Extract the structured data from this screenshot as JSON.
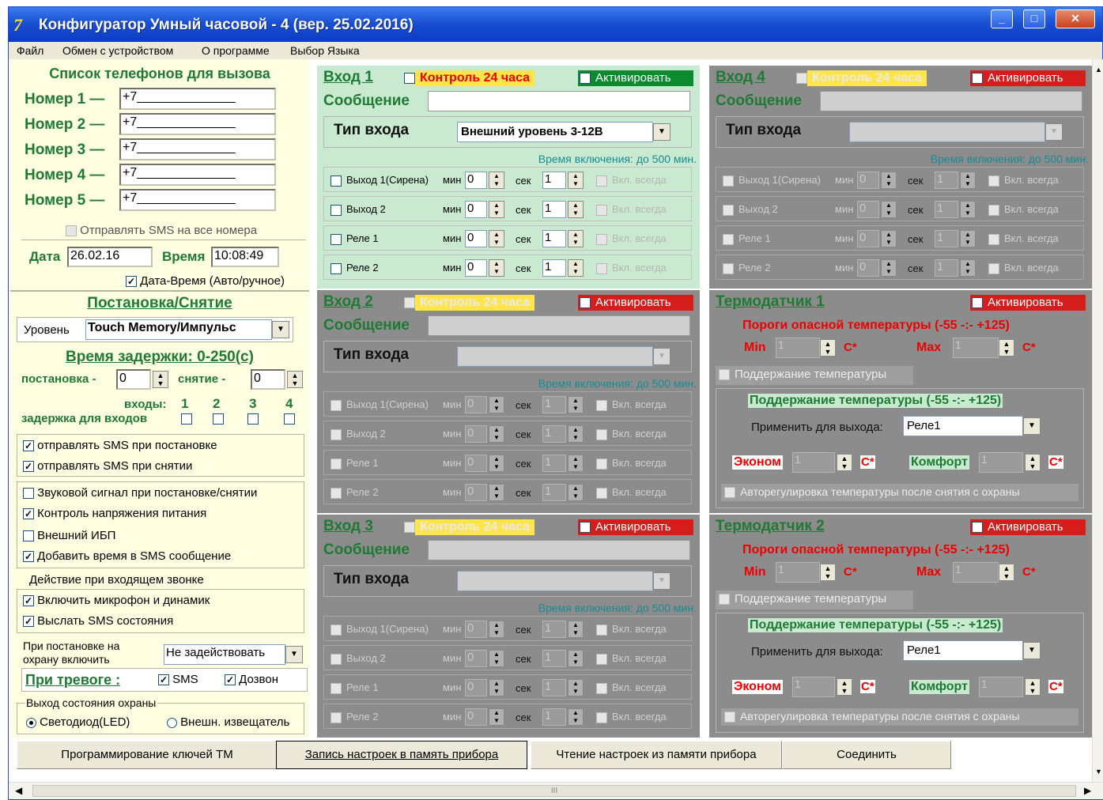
{
  "window": {
    "title": "Конфигуратор Умный часовой - 4 (вер. 25.02.2016)",
    "icon_text": "7"
  },
  "menu": [
    "Файл",
    "Обмен с устройством",
    "О программе",
    "Выбор Языка"
  ],
  "phones": {
    "header": "Список телефонов для вызова",
    "items": [
      {
        "label": "Номер 1 —",
        "value": "+7______________"
      },
      {
        "label": "Номер 2 —",
        "value": "+7______________"
      },
      {
        "label": "Номер 3 —",
        "value": "+7______________"
      },
      {
        "label": "Номер 4 —",
        "value": "+7______________"
      },
      {
        "label": "Номер 5 —",
        "value": "+7______________"
      }
    ],
    "sms_all": "Отправлять SMS на все номера"
  },
  "datetime": {
    "date_label": "Дата",
    "date_value": "26.02.16",
    "time_label": "Время",
    "time_value": "10:08:49",
    "auto_label": "Дата-Время (Авто/ручное)"
  },
  "arming": {
    "header": "Постановка/Снятие",
    "level_label": "Уровень",
    "level_value": "Touch Memory/Импульс",
    "delay_header": "Время задержки: 0-250(с)",
    "set_label": "постановка -",
    "set_value": "0",
    "unset_label": "снятие -",
    "unset_value": "0",
    "inputs_label": "входы:",
    "input_nums": [
      "1",
      "2",
      "3",
      "4"
    ],
    "input_delay_label": "задержка для входов"
  },
  "options": {
    "sms_set": "отправлять SMS при постановке",
    "sms_unset": "отправлять SMS при снятии",
    "sound": "Звуковой сигнал при постановке/снятии",
    "voltage": "Контроль напряжения питания",
    "ups": "Внешний ИБП",
    "time_sms": "Добавить время в SMS сообщение",
    "incoming_header": "Действие при входящем звонке",
    "mic": "Включить микрофон и динамик",
    "send_state": "Выслать SMS состояния",
    "on_arm_label": "При постановке на охрану включить",
    "on_arm_value": "Не задействовать",
    "alarm_label": "При тревоге :",
    "alarm_sms": "SMS",
    "alarm_call": "Дозвон",
    "out_state_label": "Выход состояния охраны",
    "led": "Светодиод(LED)",
    "ext": "Внешн. извещатель"
  },
  "common": {
    "control24": "Контроль 24 часа",
    "activate": "Активировать",
    "message": "Сообщение",
    "input_type": "Тип входа",
    "time_on": "Время включения: до 500 мин.",
    "min": "мин",
    "sec": "сек",
    "always_on": "Вкл. всегда",
    "outputs": [
      "Выход 1(Сирена)",
      "Выход 2",
      "Реле 1",
      "Реле 2"
    ]
  },
  "inputs": [
    {
      "title": "Вход 1",
      "type_value": "Внешний уровень 3-12В",
      "min_values": [
        "0",
        "0",
        "0",
        "0"
      ],
      "sec_values": [
        "1",
        "1",
        "1",
        "1"
      ]
    },
    {
      "title": "Вход 2",
      "type_value": "",
      "min_values": [
        "0",
        "0",
        "0",
        "0"
      ],
      "sec_values": [
        "1",
        "1",
        "1",
        "1"
      ]
    },
    {
      "title": "Вход 3",
      "type_value": "",
      "min_values": [
        "0",
        "0",
        "0",
        "0"
      ],
      "sec_values": [
        "1",
        "1",
        "1",
        "1"
      ]
    },
    {
      "title": "Вход 4",
      "type_value": "",
      "min_values": [
        "0",
        "0",
        "0",
        "0"
      ],
      "sec_values": [
        "1",
        "1",
        "1",
        "1"
      ]
    }
  ],
  "thermo": {
    "thresholds": "Пороги опасной температуры (-55 -:- +125)",
    "min": "Min",
    "max": "Max",
    "unit": "C*",
    "maintain_cb": "Поддержание температуры",
    "maintain_header": "Поддержание температуры (-55 -:- +125)",
    "apply_label": "Применить для выхода:",
    "apply_value": "Реле1",
    "econom": "Эконом",
    "comfort": "Комфорт",
    "auto_reg": "Авторегулировка температуры после снятия с охраны",
    "sensors": [
      {
        "title": "Термодатчик 1",
        "min_value": "1",
        "max_value": "1",
        "econom_value": "1",
        "comfort_value": "1"
      },
      {
        "title": "Термодатчик 2",
        "min_value": "1",
        "max_value": "1",
        "econom_value": "1",
        "comfort_value": "1"
      }
    ]
  },
  "buttons": {
    "prog_keys": "Программирование ключей ТМ",
    "write": "Запись настроек в память прибора",
    "read": "Чтение настроек из памяти прибора",
    "connect": "Соединить"
  },
  "scroll": {
    "thumb": "III"
  }
}
